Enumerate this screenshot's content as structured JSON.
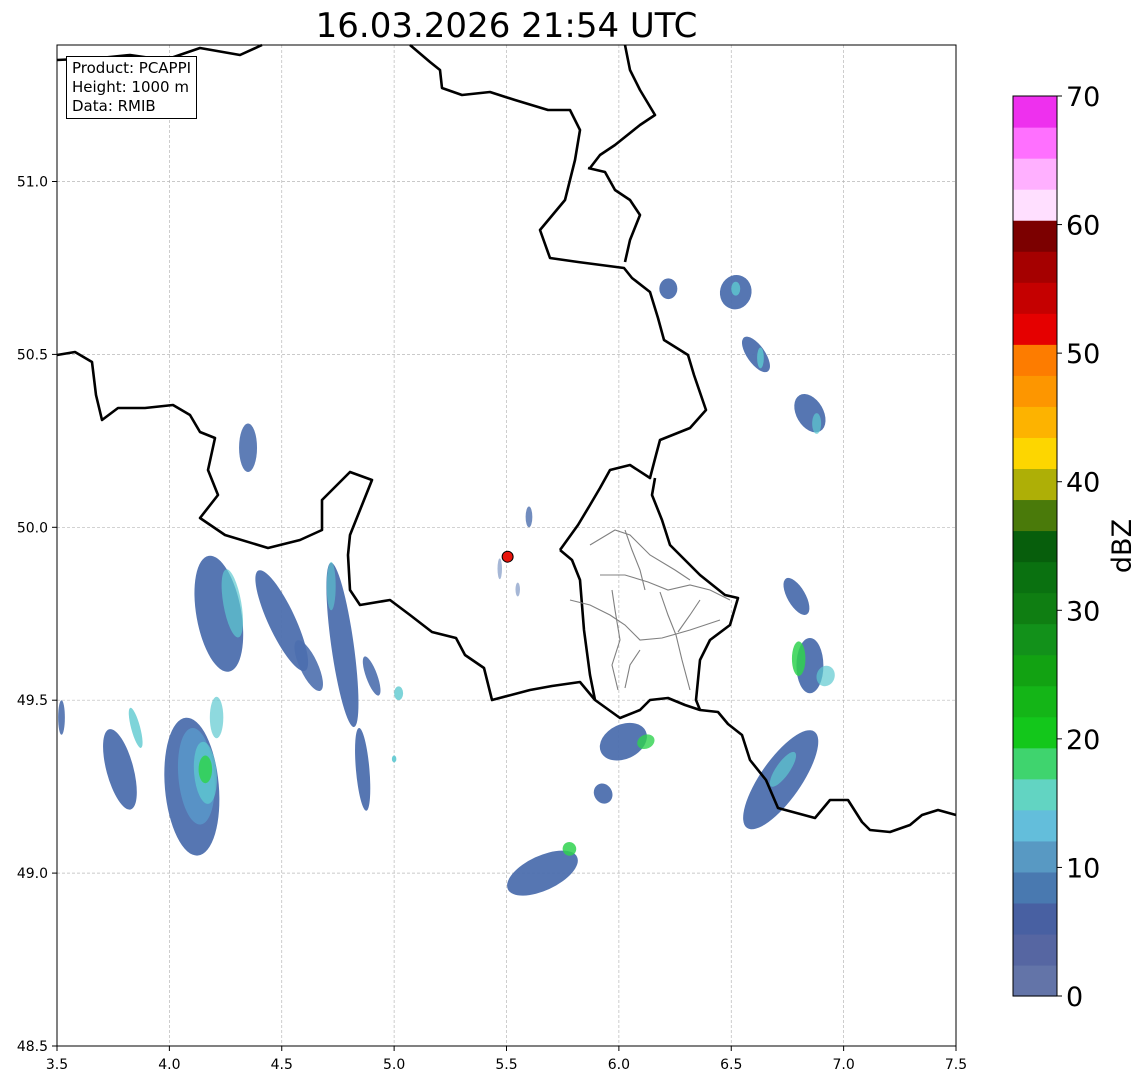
{
  "title": "16.03.2026 21:54 UTC",
  "info_box": {
    "product": "Product: PCAPPI",
    "height": "Height: 1000 m",
    "data": "Data: RMIB"
  },
  "map": {
    "lon_range": [
      3.5,
      7.5
    ],
    "lat_range": [
      48.5,
      51.4
    ],
    "x_ticks": [
      "3.5",
      "4.0",
      "4.5",
      "5.0",
      "5.5",
      "6.0",
      "6.5",
      "7.0",
      "7.5"
    ],
    "y_ticks": [
      "48.5",
      "49.0",
      "49.5",
      "50.0",
      "50.5",
      "51.0"
    ],
    "gridlines": true,
    "radar_site": {
      "lon": 5.505,
      "lat": 49.915,
      "color": "#e8140c"
    },
    "border_color": "#000000",
    "district_color": "#808080"
  },
  "colorbar": {
    "label": "dBZ",
    "range": [
      0,
      70
    ],
    "tick_labels": [
      "0",
      "10",
      "20",
      "30",
      "40",
      "50",
      "60",
      "70"
    ],
    "colors": [
      "#6374a8",
      "#5666a2",
      "#4860a2",
      "#4979b0",
      "#5899c3",
      "#63bedb",
      "#62d4c2",
      "#3fd46e",
      "#13c71b",
      "#14b517",
      "#12a212",
      "#12911a",
      "#0f7e12",
      "#0a7110",
      "#075e0c",
      "#4a7a0a",
      "#aeaf06",
      "#fdd600",
      "#fdb300",
      "#fd9600",
      "#fd7c00",
      "#e50000",
      "#c50000",
      "#a50000",
      "#7c0000",
      "#ffdfff",
      "#ffb0ff",
      "#ff70ff",
      "#ee30ee"
    ]
  },
  "echo_colors": {
    "weak": "#4d6fae",
    "light": "#5a9ccc",
    "cyan": "#5ec9d0",
    "green": "#2fd24f",
    "strong": "#14b526"
  }
}
